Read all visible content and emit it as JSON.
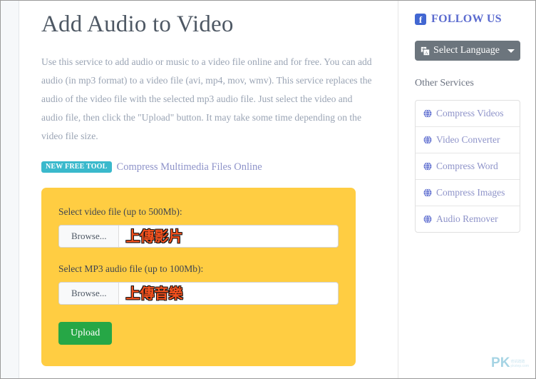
{
  "main": {
    "title": "Add Audio to Video",
    "intro": "Use this service to add audio or music to a video file online and for free. You can add audio (in mp3 format) to a video file (avi, mp4, mov, wmv). This service replaces the audio of the video file with the selected mp3 audio file. Just select the video and audio file, then click the \"Upload\" button. It may take some time depending on the video file size.",
    "promo": {
      "badge": "NEW FREE TOOL",
      "link_text": "Compress Multimedia Files Online",
      "badge_color": "#3ab9cc",
      "link_color": "#8e93c9"
    },
    "form": {
      "panel_color": "#ffcd42",
      "video_label": "Select video file (up to 500Mb):",
      "video_browse_label": "Browse...",
      "video_file_value": "上傳影片",
      "audio_label": "Select MP3 audio file (up to 100Mb):",
      "audio_browse_label": "Browse...",
      "audio_file_value": "上傳音樂",
      "upload_label": "Upload",
      "upload_color": "#26a746",
      "file_value_color": "#f4511e"
    }
  },
  "sidebar": {
    "follow_us_label": "FOLLOW US",
    "facebook_glyph": "f",
    "facebook_color": "#4267d2",
    "select_language_label": "Select Language",
    "select_language_color": "#6c757d",
    "other_services_heading": "Other Services",
    "services": [
      {
        "label": "Compress Videos"
      },
      {
        "label": "Video Converter"
      },
      {
        "label": "Compress Word"
      },
      {
        "label": "Compress Images"
      },
      {
        "label": "Audio Remover"
      }
    ]
  },
  "watermark": {
    "mark": "PK",
    "sub": "痞凱踏踏\npkstep.com"
  }
}
